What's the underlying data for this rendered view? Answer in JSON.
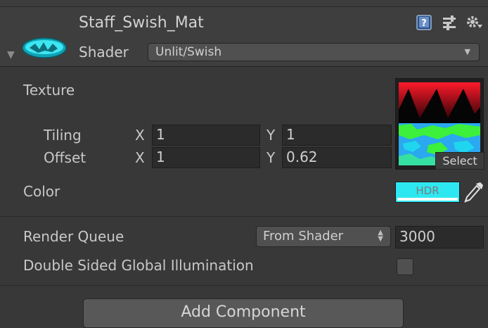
{
  "material": {
    "name": "Staff_Swish_Mat",
    "shader_label": "Shader",
    "shader_value": "Unlit/Swish",
    "icons": [
      "material-sphere-icon",
      "help-book-icon",
      "preset-sliders-icon",
      "gear-menu-icon",
      "foldout-arrow-icon"
    ]
  },
  "texture": {
    "label": "Texture",
    "tiling_label": "Tiling",
    "offset_label": "Offset",
    "x_label": "X",
    "y_label": "Y",
    "tiling_x": "1",
    "tiling_y": "1",
    "offset_x": "1",
    "offset_y": "0.62",
    "select_label": "Select"
  },
  "color": {
    "label": "Color",
    "hdr_label": "HDR",
    "swatch": "#2ee8f1",
    "picker_icon": "eyedropper-icon"
  },
  "render_queue": {
    "label": "Render Queue",
    "mode": "From Shader",
    "value": "3000"
  },
  "gi": {
    "label": "Double Sided Global Illumination",
    "checked": false
  },
  "add_component": {
    "label": "Add Component"
  }
}
